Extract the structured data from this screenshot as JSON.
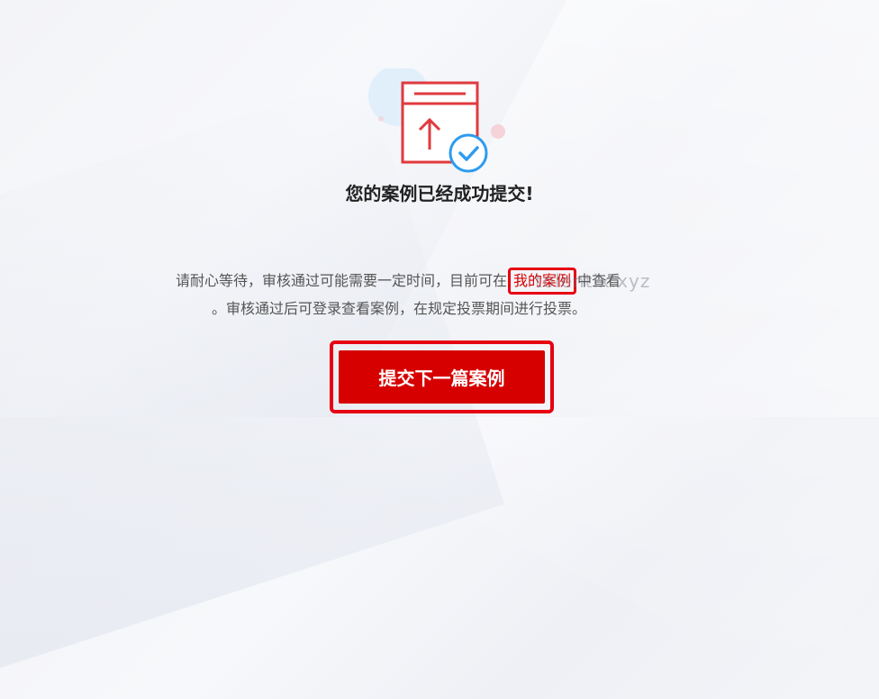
{
  "success": {
    "title": "您的案例已经成功提交!",
    "icon": "document-upload-success-icon"
  },
  "notice": {
    "line1_before_link": "请耐心等待，审核通过可能需要一定时间，目前可在",
    "link_label": "我的案例",
    "line1_after_link": "中查看",
    "line2": "。审核通过后可登录查看案例，在规定投票期间进行投票。"
  },
  "watermark": "tolentix.xyz",
  "actions": {
    "submit_next_label": "提交下一篇案例"
  },
  "colors": {
    "accent_red": "#d60000",
    "highlight_border": "#e60012",
    "check_blue": "#2e9bef"
  }
}
